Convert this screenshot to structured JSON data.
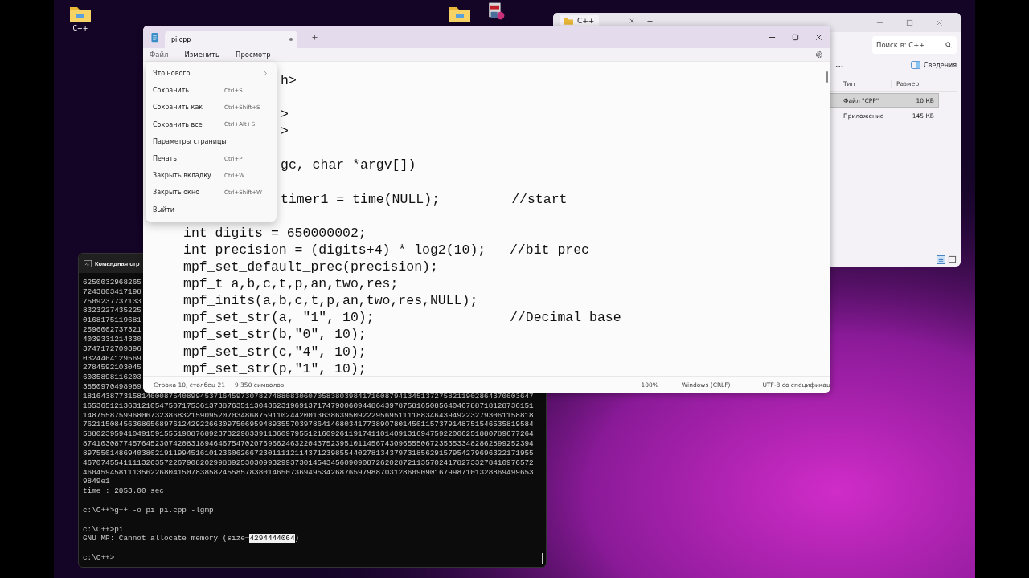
{
  "desktop": {
    "icons": [
      {
        "kind": "folder",
        "label": "C++"
      },
      {
        "kind": "folder"
      },
      {
        "kind": "package"
      }
    ]
  },
  "explorer": {
    "tab": "C++",
    "search": {
      "placeholder": "Поиск в: C++"
    },
    "more": "...",
    "details": "Сведения",
    "columns": [
      "Тип",
      "Размер"
    ],
    "rows": [
      {
        "type": "Файл \"CPP\"",
        "size": "10 КБ",
        "selected": true
      },
      {
        "type": "Приложение",
        "size": "145 КБ",
        "selected": false
      }
    ]
  },
  "console": {
    "title": "Командная стр",
    "lines": [
      {
        "text": "6250032968265"
      },
      {
        "text": "7243803417198"
      },
      {
        "text": "7509237737133"
      },
      {
        "text": "8323227435225"
      },
      {
        "text": "0168175119681"
      },
      {
        "text": "2596002737321"
      },
      {
        "text": "4039331214330"
      },
      {
        "text": "3747172709396"
      },
      {
        "text": "0324464129569"
      },
      {
        "text": "2784592103045"
      },
      {
        "text": "6035898116203"
      },
      {
        "text": "3850970498989"
      },
      {
        "text": "1816438773158146008754089945371645973078274880830607058380398417160879413451372758211902864370603647"
      },
      {
        "text": "1653651213631210547507175361373876351130436231969137174790060944864397875816508564046788718128736151"
      },
      {
        "text": "1487558759968067323868321590952070348687591102442001363863950922295695111188346439492232793061158818"
      },
      {
        "text": "7621150845636865689761242922663097506959489355703978641468034177389078014501157379148751546535819584"
      },
      {
        "text": "5880239594104915915551908768923732298339113609795512160926119174110140913169475922006251880789677264"
      },
      {
        "text": "8741030877457645230742083189464675470207696624632204375239510114567430965550672353533482862899252394"
      },
      {
        "text": "8975501486940380219119945161012360626672301111211437123985544027813437973185629157954279696322171955"
      },
      {
        "text": "4670745541111326357226790820299889253030993299373014543456090908726202872113570241782733278410976572"
      },
      {
        "text": "4604594581113562268041507838582455857838014650736949534268765979887031286090901679987101328869499653"
      },
      {
        "text": "9849e1"
      },
      {
        "text": "time : 2853.00 sec"
      },
      {
        "text": "c:\\C++>g++ -o pi pi.cpp -lgmp",
        "blank_before": true
      },
      {
        "text": "c:\\C++>pi",
        "blank_before": true
      },
      {
        "segments": [
          {
            "text": "GNU MP: Cannot allocate memory (size=",
            "selected": false
          },
          {
            "text": "4294444064",
            "selected": true
          },
          {
            "text": ")",
            "selected": false
          }
        ]
      },
      {
        "text": "c:\\C++>",
        "blank_before": true
      }
    ]
  },
  "notepad": {
    "tab": {
      "title": "pi.cpp",
      "modified": true
    },
    "menu": [
      "Файл",
      "Изменить",
      "Просмотр"
    ],
    "file_menu": [
      {
        "label": "Что нового",
        "submenu": true
      },
      {
        "label": "Сохранить",
        "shortcut": "Ctrl+S"
      },
      {
        "label": "Сохранить как",
        "shortcut": "Ctrl+Shift+S"
      },
      {
        "label": "Сохранить все",
        "shortcut": "Ctrl+Alt+S"
      },
      {
        "label": "Параметры страницы"
      },
      {
        "label": "Печать",
        "shortcut": "Ctrl+P"
      },
      {
        "label": "Закрыть вкладку",
        "shortcut": "Ctrl+W"
      },
      {
        "label": "Закрыть окно",
        "shortcut": "Ctrl+Shift+W"
      },
      {
        "label": "Выйти"
      }
    ],
    "code": [
      {
        "kind": "partial",
        "text": "h>"
      },
      {
        "kind": "partial",
        "text": ">",
        "blank_before": true
      },
      {
        "kind": "partial",
        "text": ">"
      },
      {
        "kind": "partial",
        "text": "gc, char *argv[])",
        "blank_before": true
      },
      {
        "kind": "partial",
        "text": "timer1 = time(NULL);         //start",
        "blank_before": true
      },
      {
        "kind": "line",
        "text": "int digits = 650000002;",
        "blank_before": true
      },
      {
        "kind": "line",
        "text": "int precision = (digits+4) * log2(10);   //bit prec"
      },
      {
        "kind": "line",
        "text": "mpf_set_default_prec(precision);"
      },
      {
        "kind": "line",
        "text": "mpf_t a,b,c,t,p,an,two,res;"
      },
      {
        "kind": "line",
        "text": "mpf_inits(a,b,c,t,p,an,two,res,NULL);"
      },
      {
        "kind": "line",
        "text": "mpf_set_str(a, \"1\", 10);                 //Decimal base"
      },
      {
        "kind": "line",
        "text": "mpf_set_str(b,\"0\", 10);"
      },
      {
        "kind": "line",
        "text": "mpf_set_str(c,\"4\", 10);"
      },
      {
        "kind": "line",
        "text": "mpf_set_str(p,\"1\", 10);"
      }
    ],
    "status": {
      "position": "Строка 10, столбец 21",
      "chars": "9 350 символов",
      "zoom": "100%",
      "eol": "Windows (CRLF)",
      "encoding": "UTF-8 со спецификац"
    }
  }
}
